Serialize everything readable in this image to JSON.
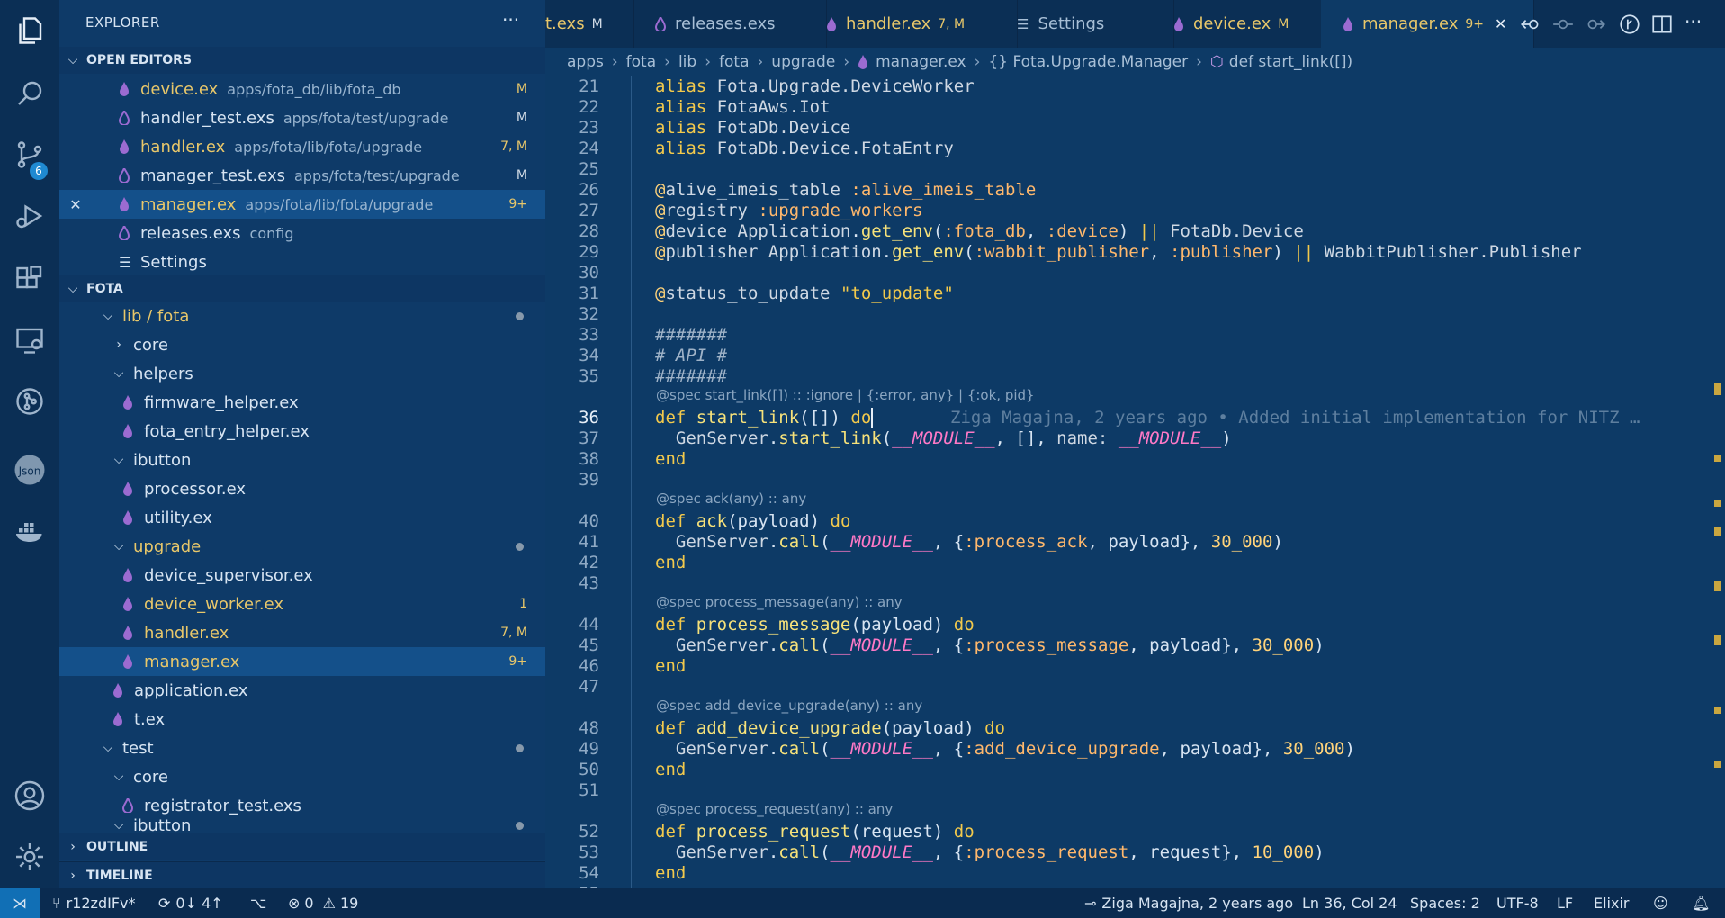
{
  "activity": {
    "scm_badge": "6"
  },
  "sidebar": {
    "title": "EXPLORER",
    "more": "···",
    "open_editors_header": "OPEN EDITORS",
    "open_editors": [
      {
        "name": "device.ex",
        "path": "apps/fota_db/lib/fota_db",
        "status": "M"
      },
      {
        "name": "handler_test.exs",
        "path": "apps/fota/test/upgrade",
        "status": "M"
      },
      {
        "name": "handler.ex",
        "path": "apps/fota/lib/fota/upgrade",
        "status": "7, M"
      },
      {
        "name": "manager_test.exs",
        "path": "apps/fota/test/upgrade",
        "status": "M"
      },
      {
        "name": "manager.ex",
        "path": "apps/fota/lib/fota/upgrade",
        "status": "9+"
      },
      {
        "name": "releases.exs",
        "path": "config",
        "status": ""
      },
      {
        "name": "Settings",
        "path": "",
        "status": ""
      }
    ],
    "folder_header": "FOTA",
    "tree": {
      "lib_fota": "lib / fota",
      "core": "core",
      "helpers": "helpers",
      "firmware_helper": "firmware_helper.ex",
      "fota_entry_helper": "fota_entry_helper.ex",
      "ibutton": "ibutton",
      "processor": "processor.ex",
      "utility": "utility.ex",
      "upgrade": "upgrade",
      "device_supervisor": "device_supervisor.ex",
      "device_worker": "device_worker.ex",
      "device_worker_status": "1",
      "handler": "handler.ex",
      "handler_status": "7, M",
      "manager": "manager.ex",
      "manager_status": "9+",
      "application": "application.ex",
      "t": "t.ex",
      "test": "test",
      "test_core": "core",
      "registrator_test": "registrator_test.exs",
      "ibutton2": "ibutton"
    },
    "outline": "OUTLINE",
    "timeline": "TIMELINE"
  },
  "tabs": [
    {
      "label": "t.exs",
      "mod": "M"
    },
    {
      "label": "releases.exs",
      "mod": ""
    },
    {
      "label": "handler.ex",
      "mod": "7, M"
    },
    {
      "label": "Settings",
      "mod": ""
    },
    {
      "label": "device.ex",
      "mod": "M"
    },
    {
      "label": "manager.ex",
      "mod": "9+"
    }
  ],
  "breadcrumb": [
    "apps",
    "fota",
    "lib",
    "fota",
    "upgrade",
    "manager.ex",
    "{} Fota.Upgrade.Manager",
    "def start_link([])"
  ],
  "editor": {
    "lines": {
      "21": "alias Fota.Upgrade.DeviceWorker",
      "22": "alias FotaAws.Iot",
      "23": "alias FotaDb.Device",
      "24": "alias FotaDb.Device.FotaEntry",
      "25": "",
      "26": "@alive_imeis_table :alive_imeis_table",
      "27": "@registry :upgrade_workers",
      "28": "@device Application.get_env(:fota_db, :device) || FotaDb.Device",
      "29": "@publisher Application.get_env(:wabbit_publisher, :publisher) || WabbitPublisher.Publisher",
      "30": "",
      "31": "@status_to_update \"to_update\"",
      "32": "",
      "33": "#######",
      "34": "# API #",
      "35": "#######",
      "36": "def start_link([]) do",
      "37": "  GenServer.start_link(__MODULE__, [], name: __MODULE__)",
      "38": "end",
      "39": "",
      "40": "def ack(payload) do",
      "41": "  GenServer.call(__MODULE__, {:process_ack, payload}, 30_000)",
      "42": "end",
      "43": "",
      "44": "def process_message(payload) do",
      "45": "  GenServer.call(__MODULE__, {:process_message, payload}, 30_000)",
      "46": "end",
      "47": "",
      "48": "def add_device_upgrade(payload) do",
      "49": "  GenServer.call(__MODULE__, {:add_device_upgrade, payload}, 30_000)",
      "50": "end",
      "51": "",
      "52": "def process_request(request) do",
      "53": "  GenServer.call(__MODULE__, {:process_request, request}, 10_000)",
      "54": "end",
      "55": ""
    },
    "lens": {
      "start_link": "@spec start_link([]) :: :ignore | {:error, any} | {:ok, pid}",
      "ack": "@spec ack(any) :: any",
      "process_message": "@spec process_message(any) :: any",
      "add_device_upgrade": "@spec add_device_upgrade(any) :: any",
      "process_request": "@spec process_request(any) :: any"
    },
    "blame": "Ziga Magajna, 2 years ago • Added initial implementation for NITZ …"
  },
  "status": {
    "branch": "r12zdIFv*",
    "sync": "0↓ 4↑",
    "errors": "0",
    "warnings": "19",
    "blame": "Ziga Magajna, 2 years ago",
    "position": "Ln 36, Col 24",
    "spaces": "Spaces: 2",
    "encoding": "UTF-8",
    "eol": "LF",
    "language": "Elixir"
  },
  "colors": {
    "background": "#0d3a66",
    "sidebar": "#0e3a68",
    "activity": "#0b2f55",
    "modified": "#e8c76a",
    "accent": "#116fb5",
    "selection": "#14508a"
  },
  "icons": [
    "files-icon",
    "search-icon",
    "source-control-icon",
    "run-debug-icon",
    "extensions-icon",
    "remote-explorer-icon",
    "git-graph-icon",
    "json-icon",
    "docker-icon",
    "account-icon",
    "settings-gear-icon",
    "elixir-drop-icon",
    "close-icon",
    "split-editor-icon"
  ]
}
